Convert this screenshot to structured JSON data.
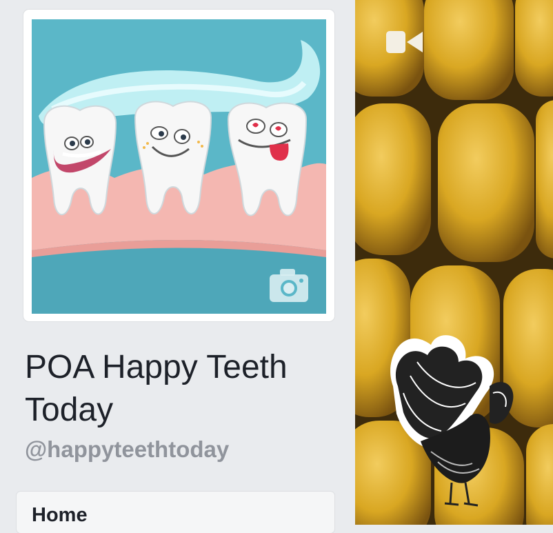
{
  "page": {
    "title": "POA Happy Teeth Today",
    "handle": "@happyteethtoday"
  },
  "nav": {
    "items": [
      {
        "label": "Home"
      }
    ]
  },
  "profile_photo": {
    "icon": "camera-icon"
  },
  "cover_photo": {
    "icon": "video-camera-icon"
  },
  "colors": {
    "background": "#e9ebee",
    "title_text": "#1d2129",
    "handle_text": "#90949c",
    "illustration_bg": "#5bb7c8",
    "gum": "#f4b7b1",
    "toothpaste": "#bfeff3",
    "corn": "#d9a722"
  }
}
